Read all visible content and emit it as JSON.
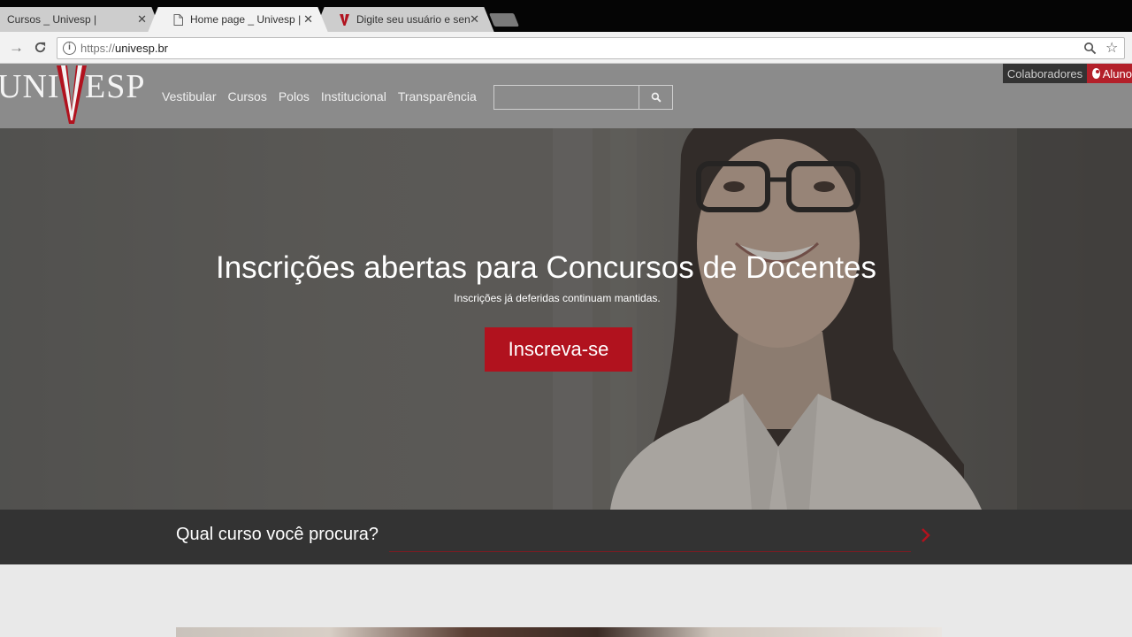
{
  "browser": {
    "tabs": [
      {
        "title": "Cursos _ Univesp |",
        "active": false
      },
      {
        "title": "Home page _ Univesp |",
        "active": true
      },
      {
        "title": "Digite seu usuário e senh",
        "active": false
      }
    ],
    "url_scheme": "https://",
    "url_host": "univesp.br"
  },
  "header": {
    "logo_left": "UNI",
    "logo_right": "ESP",
    "nav": [
      "Vestibular",
      "Cursos",
      "Polos",
      "Institucional",
      "Transparência"
    ],
    "search_placeholder": "",
    "colaboradores": "Colaboradores",
    "aluno": "Aluno"
  },
  "hero": {
    "title": "Inscrições abertas para Concursos de Docentes",
    "subtitle": "Inscrições já deferidas continuam mantidas.",
    "cta": "Inscreva-se"
  },
  "course_search": {
    "label": "Qual curso você procura?"
  },
  "colors": {
    "brand_red": "#b1121e",
    "header_gray": "#8b8b8b",
    "course_bar": "#333333"
  },
  "icons": {
    "search": "search-icon",
    "user": "user-icon",
    "arrow": "chevron-right-icon"
  }
}
